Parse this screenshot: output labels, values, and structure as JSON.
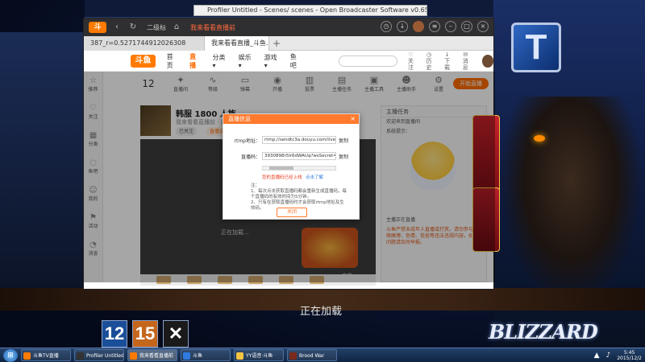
{
  "desktop": {
    "loading_text": "正在加载",
    "publisher": "BLIZZARD",
    "tiles": [
      "12",
      "15",
      "✕"
    ],
    "t_logo": "T"
  },
  "top_window": {
    "title": "Profiler Untitled - Scenes/ scenes - Open Broadcaster Software v0.657b - 0684"
  },
  "app": {
    "title_label": "二级标",
    "live_label": "我来看看直播前",
    "tabs": [
      "387_r=0.5271744912026308",
      "我来看看直播_斗鱼..."
    ],
    "nav": [
      "首页",
      "直播",
      "分类▾",
      "娱乐▾",
      "游戏▾",
      "鱼吧"
    ],
    "search_placeholder": "",
    "header_icons": [
      "关注",
      "历史",
      "下载",
      "消息"
    ],
    "sidebar": [
      "推荐",
      "关注",
      "分类",
      "鱼吧",
      "我的",
      "活动",
      "消息"
    ],
    "tools": [
      "12",
      "直播间",
      "等级",
      "弹幕",
      "开播",
      "投票",
      "主播任务",
      "主播工具",
      "主播助手",
      "设置"
    ],
    "start_live": "开始直播",
    "room": {
      "title": "韩服 1800 人族",
      "subtitle": "我来看看直播前 · 星际争霸 · 房间号",
      "tags": [
        "已关注",
        "直播设置"
      ]
    },
    "player": {
      "loading": "正在加载...",
      "ad_label": "广告"
    },
    "chat": {
      "header": "主播任务",
      "messages": [
        "欢迎来到直播间",
        "系统提示：",
        "主播正在直播"
      ],
      "notice": "斗鱼严禁未成年人直播或打赏。请勿参与网络赌博、色情、低俗等违法违规内容，如遇问题请及时举报。"
    }
  },
  "modal": {
    "title": "直播信息",
    "rtmp_label": "rtmp地址：",
    "rtmp_value": "rtmp://sendtc3a.douyu.com/live",
    "stream_label": "直播码：",
    "stream_value": "3930898r5lr6dWAUq?wsSecret=**********",
    "copy": "复制",
    "warning": "您的直播码已经上线",
    "learn_more": "点击了解",
    "notes_title": "注：",
    "notes": [
      "1、每次点击获取直播码都会重新生成直播码，每个直播码的有效时间为5分钟。",
      "2、只有在获取直播码时才会获取rtmp地址及生效码。"
    ],
    "close": "关闭"
  },
  "taskbar": {
    "items": [
      "斗鱼TV直播",
      "Profiler Untitled",
      "我来看看直播前",
      "斗鱼",
      "YY语音·斗鱼",
      "Brood War"
    ],
    "time": "5:45",
    "date": "2015/12/2"
  },
  "colors": {
    "accent": "#ff7a2d",
    "brand": "#ff7a00",
    "taskbar": "#1c3458"
  }
}
